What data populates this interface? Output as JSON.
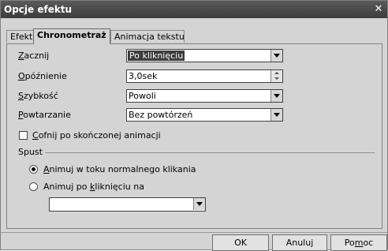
{
  "window": {
    "title": "Opcje efektu"
  },
  "tabs": [
    {
      "label": "Efekt"
    },
    {
      "label": "Chronometraż"
    },
    {
      "label": "Animacja tekstu"
    }
  ],
  "fields": {
    "start": {
      "label": "Zacznij",
      "value": "Po kliknięciu"
    },
    "delay": {
      "label": "Opóźnienie",
      "value": "3,0sek"
    },
    "speed": {
      "label": "Szybkość",
      "value": "Powoli"
    },
    "repeat": {
      "label": "Powtarzanie",
      "value": "Bez powtórzeń"
    }
  },
  "rewind_checkbox": {
    "label": "Cofnij po skończonej animacji",
    "checked": false
  },
  "trigger": {
    "group_label": "Spust",
    "option_normal": "Animuj w toku normalnego klikania",
    "option_click": "Animuj po kliknięciu na",
    "selected": "option_normal",
    "shape_value": ""
  },
  "buttons": {
    "ok": "OK",
    "cancel": "Anuluj",
    "help": "Pomoc"
  }
}
